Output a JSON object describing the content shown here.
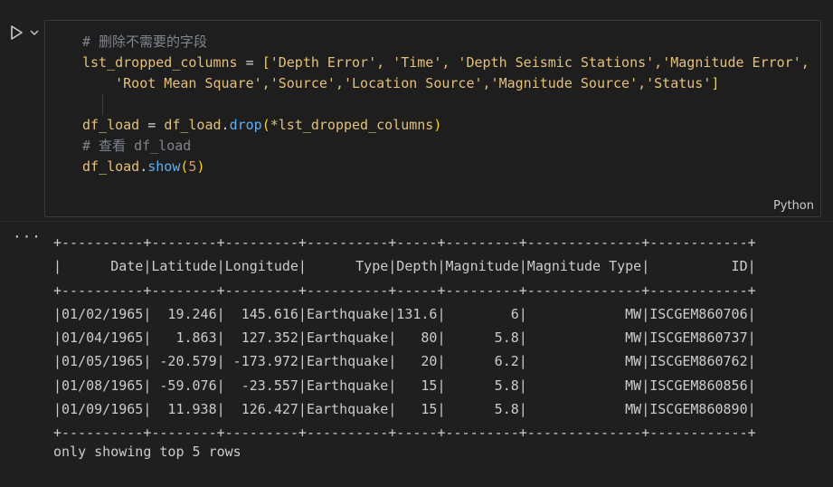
{
  "cell": {
    "language": "Python",
    "code_lines": [
      {
        "comment": "# 删除不需要的字段"
      },
      {
        "var": "lst_dropped_columns",
        "op": " = ",
        "bracket": "[",
        "strings": "'Depth Error', 'Time', 'Depth Seismic Stations','Magnitude Error',"
      },
      {
        "indent": "    ",
        "strings": "'Root Mean Square','Source','Location Source','Magnitude Source','Status'",
        "bracket": "]"
      },
      {
        "blank": ""
      },
      {
        "var": "df_load",
        "op": " = ",
        "obj": "df_load",
        "dot": ".",
        "fn": "drop",
        "open": "(",
        "arg": "*lst_dropped_columns",
        "close": ")"
      },
      {
        "comment": "# 查看 df_load"
      },
      {
        "obj": "df_load",
        "dot": ".",
        "fn": "show",
        "open": "(",
        "num": "5",
        "close": ")"
      }
    ]
  },
  "output": {
    "table_lines": [
      "+----------+--------+---------+----------+-----+---------+--------------+------------+",
      "|      Date|Latitude|Longitude|      Type|Depth|Magnitude|Magnitude Type|          ID|",
      "+----------+--------+---------+----------+-----+---------+--------------+------------+",
      "|01/02/1965|  19.246|  145.616|Earthquake|131.6|        6|            MW|ISCGEM860706|",
      "|01/04/1965|   1.863|  127.352|Earthquake|   80|      5.8|            MW|ISCGEM860737|",
      "|01/05/1965| -20.579| -173.972|Earthquake|   20|      6.2|            MW|ISCGEM860762|",
      "|01/08/1965| -59.076|  -23.557|Earthquake|   15|      5.8|            MW|ISCGEM860856|",
      "|01/09/1965|  11.938|  126.427|Earthquake|   15|      5.8|            MW|ISCGEM860890|",
      "+----------+--------+---------+----------+-----+---------+--------------+------------+"
    ],
    "footer": "only showing top 5 rows",
    "menu_glyph": "···"
  },
  "icons": {
    "run": "play-icon",
    "run_menu": "chevron-down-icon"
  }
}
